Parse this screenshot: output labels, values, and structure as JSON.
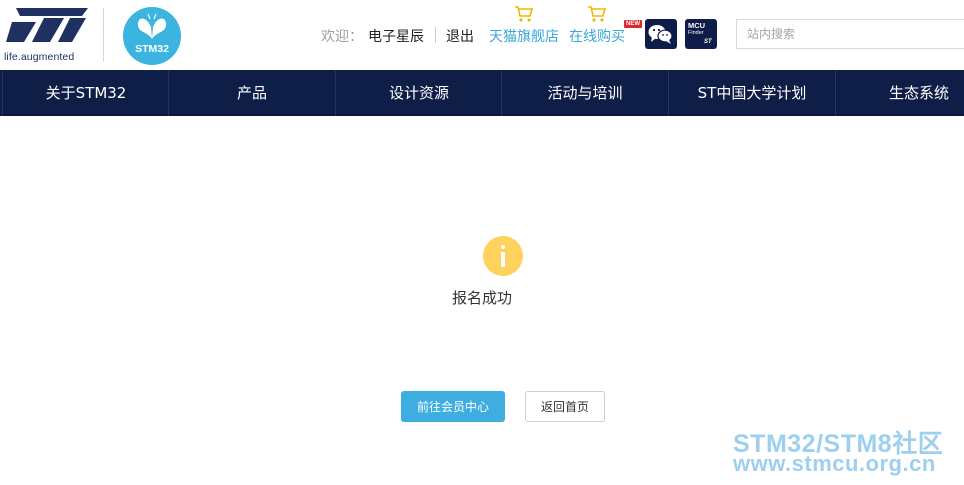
{
  "header": {
    "st_tagline": "life.augmented",
    "stm32_logo_text": "STM32",
    "welcome_label": "欢迎：",
    "username": "电子星辰",
    "logout_label": "退出",
    "tmall_label": "天猫旗舰店",
    "online_buy_label": "在线购买",
    "new_badge": "NEW",
    "mcu_finder": {
      "line1": "MCU",
      "line2": "Finder",
      "line3": "ST"
    },
    "search": {
      "placeholder": "站内搜索",
      "value": ""
    }
  },
  "nav": {
    "items": [
      {
        "label": "关于STM32"
      },
      {
        "label": "产品"
      },
      {
        "label": "设计资源"
      },
      {
        "label": "活动与培训"
      },
      {
        "label": "ST中国大学计划"
      },
      {
        "label": "生态系统"
      }
    ]
  },
  "main": {
    "message": "报名成功",
    "primary_button": "前往会员中心",
    "secondary_button": "返回首页"
  },
  "watermark": {
    "line1": "STM32/STM8社区",
    "line2": "www.stmcu.org.cn"
  },
  "colors": {
    "nav_bg": "#0f1e47",
    "accent_blue": "#3daedf",
    "link_blue": "#39a7d8",
    "info_yellow": "#ffd25d"
  }
}
